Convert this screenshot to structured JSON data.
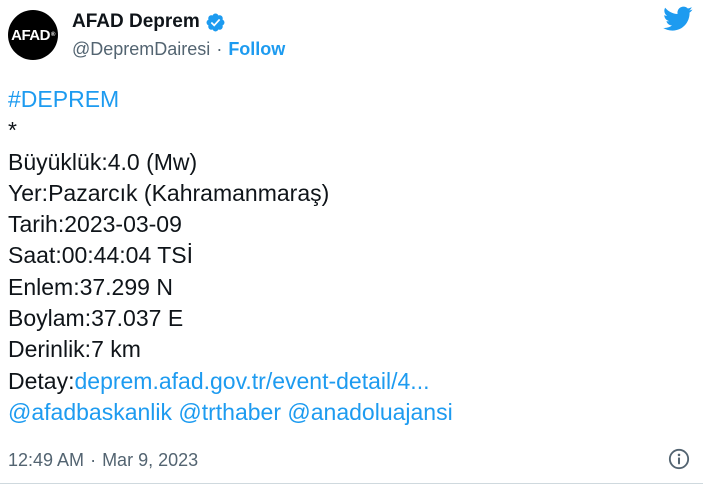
{
  "header": {
    "avatar_text": "AFAD",
    "display_name": "AFAD Deprem",
    "handle": "@DepremDairesi",
    "separator": "·",
    "follow_label": "Follow",
    "verified_icon": "verified-badge-icon",
    "brand_icon": "twitter-bird-icon",
    "accent_color": "#1d9bf0"
  },
  "tweet": {
    "hashtag": "#DEPREM",
    "bullet": "*",
    "magnitude": "Büyüklük:4.0 (Mw)",
    "location": "Yer:Pazarcık (Kahramanmaraş)",
    "date": "Tarih:2023-03-09",
    "time": "Saat:00:44:04 TSİ",
    "latitude": "Enlem:37.299 N",
    "longitude": "Boylam:37.037 E",
    "depth": "Derinlik:7 km",
    "detail_label": "Detay:",
    "detail_link": "deprem.afad.gov.tr/event-detail/4...",
    "mention_1": "@afadbaskanlik",
    "mention_2": "@trthaber",
    "mention_3": "@anadoluajansi"
  },
  "footer": {
    "time": "12:49 AM",
    "separator": "·",
    "date": "Mar 9, 2023",
    "info_icon": "info-icon"
  }
}
